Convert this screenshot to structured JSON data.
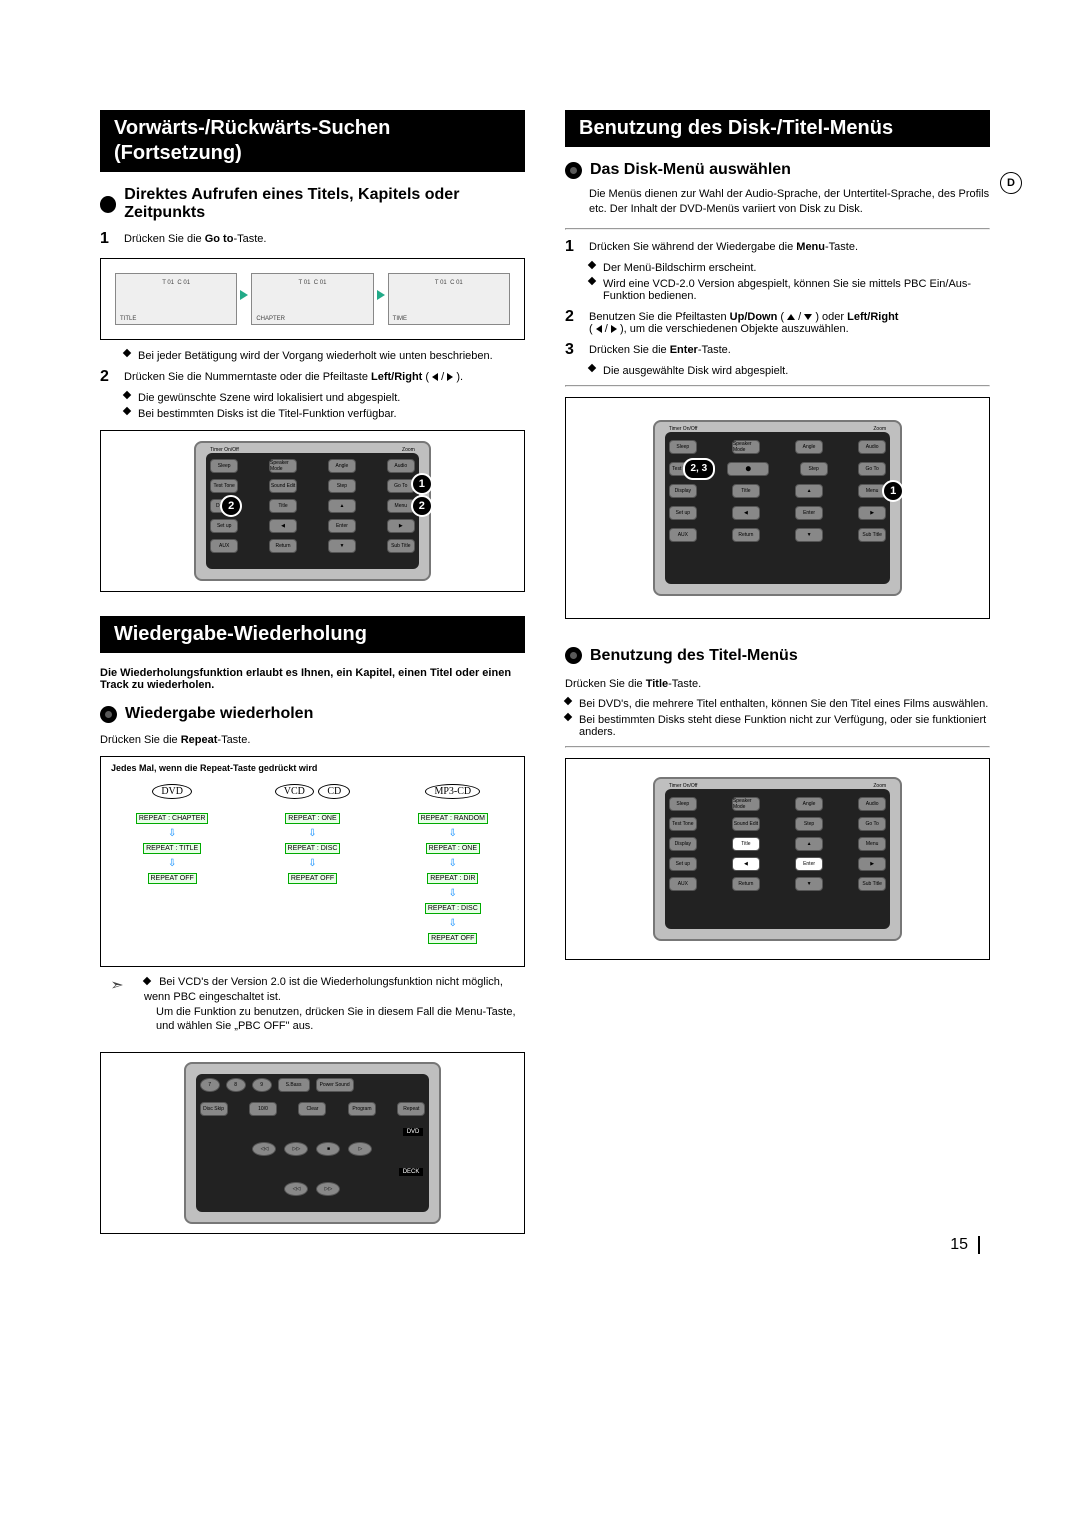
{
  "page_number": "15",
  "lang_indicator": "D",
  "left": {
    "title1_a": "Vorwärts-/Rückwärts-Suchen",
    "title1_b": "(Fortsetzung)",
    "sub1": "Direktes Aufrufen eines Titels, Kapitels oder Zeitpunkts",
    "step1_pre": "Drücken Sie die ",
    "step1_bold": "Go to",
    "step1_post": "-Taste.",
    "panels": {
      "p1": "TITLE",
      "p2": "CHAPTER",
      "p3": "TIME"
    },
    "note_loop": "Bei jeder Betätigung wird der Vorgang wiederholt wie unten beschrieben.",
    "step2_pre": "Drücken Sie die Nummerntaste oder die Pfeiltaste ",
    "step2_bold": "Left/Right",
    "step2_post": " ( ◀ / ▶ ).",
    "step2_d1": "Die gewünschte Szene wird lokalisiert und abgespielt.",
    "step2_d2": "Bei bestimmten Disks ist die Titel-Funktion verfügbar.",
    "title2": "Wiedergabe-Wiederholung",
    "intro": "Die Wiederholungsfunktion erlaubt es Ihnen, ein Kapitel, einen Titel oder einen Track zu wiederholen.",
    "sub2": "Wiedergabe wiederholen",
    "press_repeat_pre": "Drücken Sie die ",
    "press_repeat_bold": "Repeat",
    "press_repeat_post": "-Taste.",
    "box_title": "Jedes Mal, wenn die Repeat-Taste gedrückt wird",
    "disc1": "DVD",
    "disc2a": "VCD",
    "disc2b": "CD",
    "disc3": "MP3-CD",
    "dvd_modes": [
      "REPEAT : CHAPTER",
      "REPEAT : TITLE",
      "REPEAT OFF"
    ],
    "vcd_modes": [
      "REPEAT : ONE",
      "REPEAT : DISC",
      "REPEAT OFF"
    ],
    "mp3_modes": [
      "REPEAT : RANDOM",
      "REPEAT : ONE",
      "REPEAT : DIR",
      "REPEAT : DISC",
      "REPEAT OFF"
    ],
    "note1": "Bei VCD's der Version 2.0 ist die Wiederholungsfunktion nicht möglich, wenn PBC eingeschaltet ist.",
    "note2": "Um die Funktion zu benutzen, drücken Sie in diesem Fall die Menu-Taste, und wählen Sie „PBC OFF\" aus."
  },
  "right": {
    "title1": "Benutzung des Disk-/Titel-Menüs",
    "sub1": "Das Disk-Menü auswählen",
    "intro1": "Die Menüs dienen zur Wahl der Audio-Sprache, der Untertitel-Sprache, des Profils etc. Der Inhalt der DVD-Menüs variiert von Disk zu Disk.",
    "s1_pre": "Drücken Sie während der Wiedergabe die ",
    "s1_bold": "Menu",
    "s1_post": "-Taste.",
    "s1_d1": "Der Menü-Bildschirm erscheint.",
    "s1_d2": "Wird eine VCD-2.0 Version abgespielt, können Sie sie mittels PBC Ein/Aus-Funktion bedienen.",
    "s2_pre": "Benutzen Sie die Pfeiltasten ",
    "s2_bold1": "Up/Down",
    "s2_mid": " ( ▲ / ▼ ) oder ",
    "s2_bold2": "Left/Right",
    "s2_post": "( ◀ / ▶ ), um die verschiedenen Objekte auszuwählen.",
    "s3_pre": "Drücken Sie die ",
    "s3_bold": "Enter",
    "s3_post": "-Taste.",
    "s3_d1": "Die ausgewählte Disk wird abgespielt.",
    "sub2": "Benutzung des Titel-Menüs",
    "press_title_pre": "Drücken Sie die ",
    "press_title_bold": "Title",
    "press_title_post": "-Taste.",
    "d1": "Bei DVD's, die mehrere Titel enthalten, können Sie den Titel eines Films auswählen.",
    "d2": "Bei bestimmten Disks steht diese Funktion nicht zur Verfügung, oder sie funktioniert anders."
  },
  "remote_rows": [
    "Sleep",
    "Speaker Mode",
    "Angle",
    "Audio",
    "Test Tone",
    "Sound Edit",
    "Step",
    "Go To",
    "Display",
    "Title",
    "▲",
    "Menu",
    "Set up",
    "◀",
    "Enter",
    "▶",
    "AUX",
    "Return",
    "▼",
    "Sub Title"
  ],
  "remote_top": {
    "left": "Timer On/Off",
    "right": "Zoom"
  },
  "remote3_rows": [
    "7",
    "8",
    "9",
    "S.Bass",
    "Power Sound",
    "Disc Skip",
    "10/0",
    "Clear",
    "Program",
    "Repeat"
  ],
  "remote3_labels": {
    "dvd": "DVD",
    "deck": "DECK"
  },
  "markers": {
    "m1": "1",
    "m2": "2",
    "m23": "2, 3"
  }
}
